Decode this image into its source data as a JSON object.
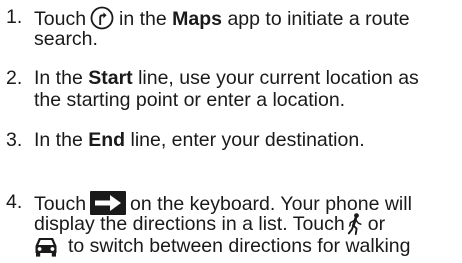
{
  "steps": [
    {
      "number": "1.",
      "line1": {
        "before": "Touch",
        "icon": "route-search-icon",
        "after": "in the",
        "bold": "Maps",
        "after2": "app to initiate a route"
      },
      "line2": "search."
    },
    {
      "number": "2.",
      "line1": {
        "before": "In the",
        "bold": "Start",
        "after": "line, use your current location as"
      },
      "line2": "the starting point or enter a location."
    },
    {
      "number": "3.",
      "line1": {
        "before": "In the",
        "bold": "End",
        "after": "line, enter your destination."
      }
    },
    {
      "number": "4.",
      "line1": {
        "before": "Touch",
        "icon": "enter-arrow-icon",
        "after": "on the keyboard. Your phone will"
      },
      "line2": {
        "before": "display the directions in a list. Touch",
        "icon": "walking-icon",
        "after": "or"
      },
      "line3": {
        "icon": "car-icon",
        "after": "to switch between directions for walking"
      }
    }
  ]
}
